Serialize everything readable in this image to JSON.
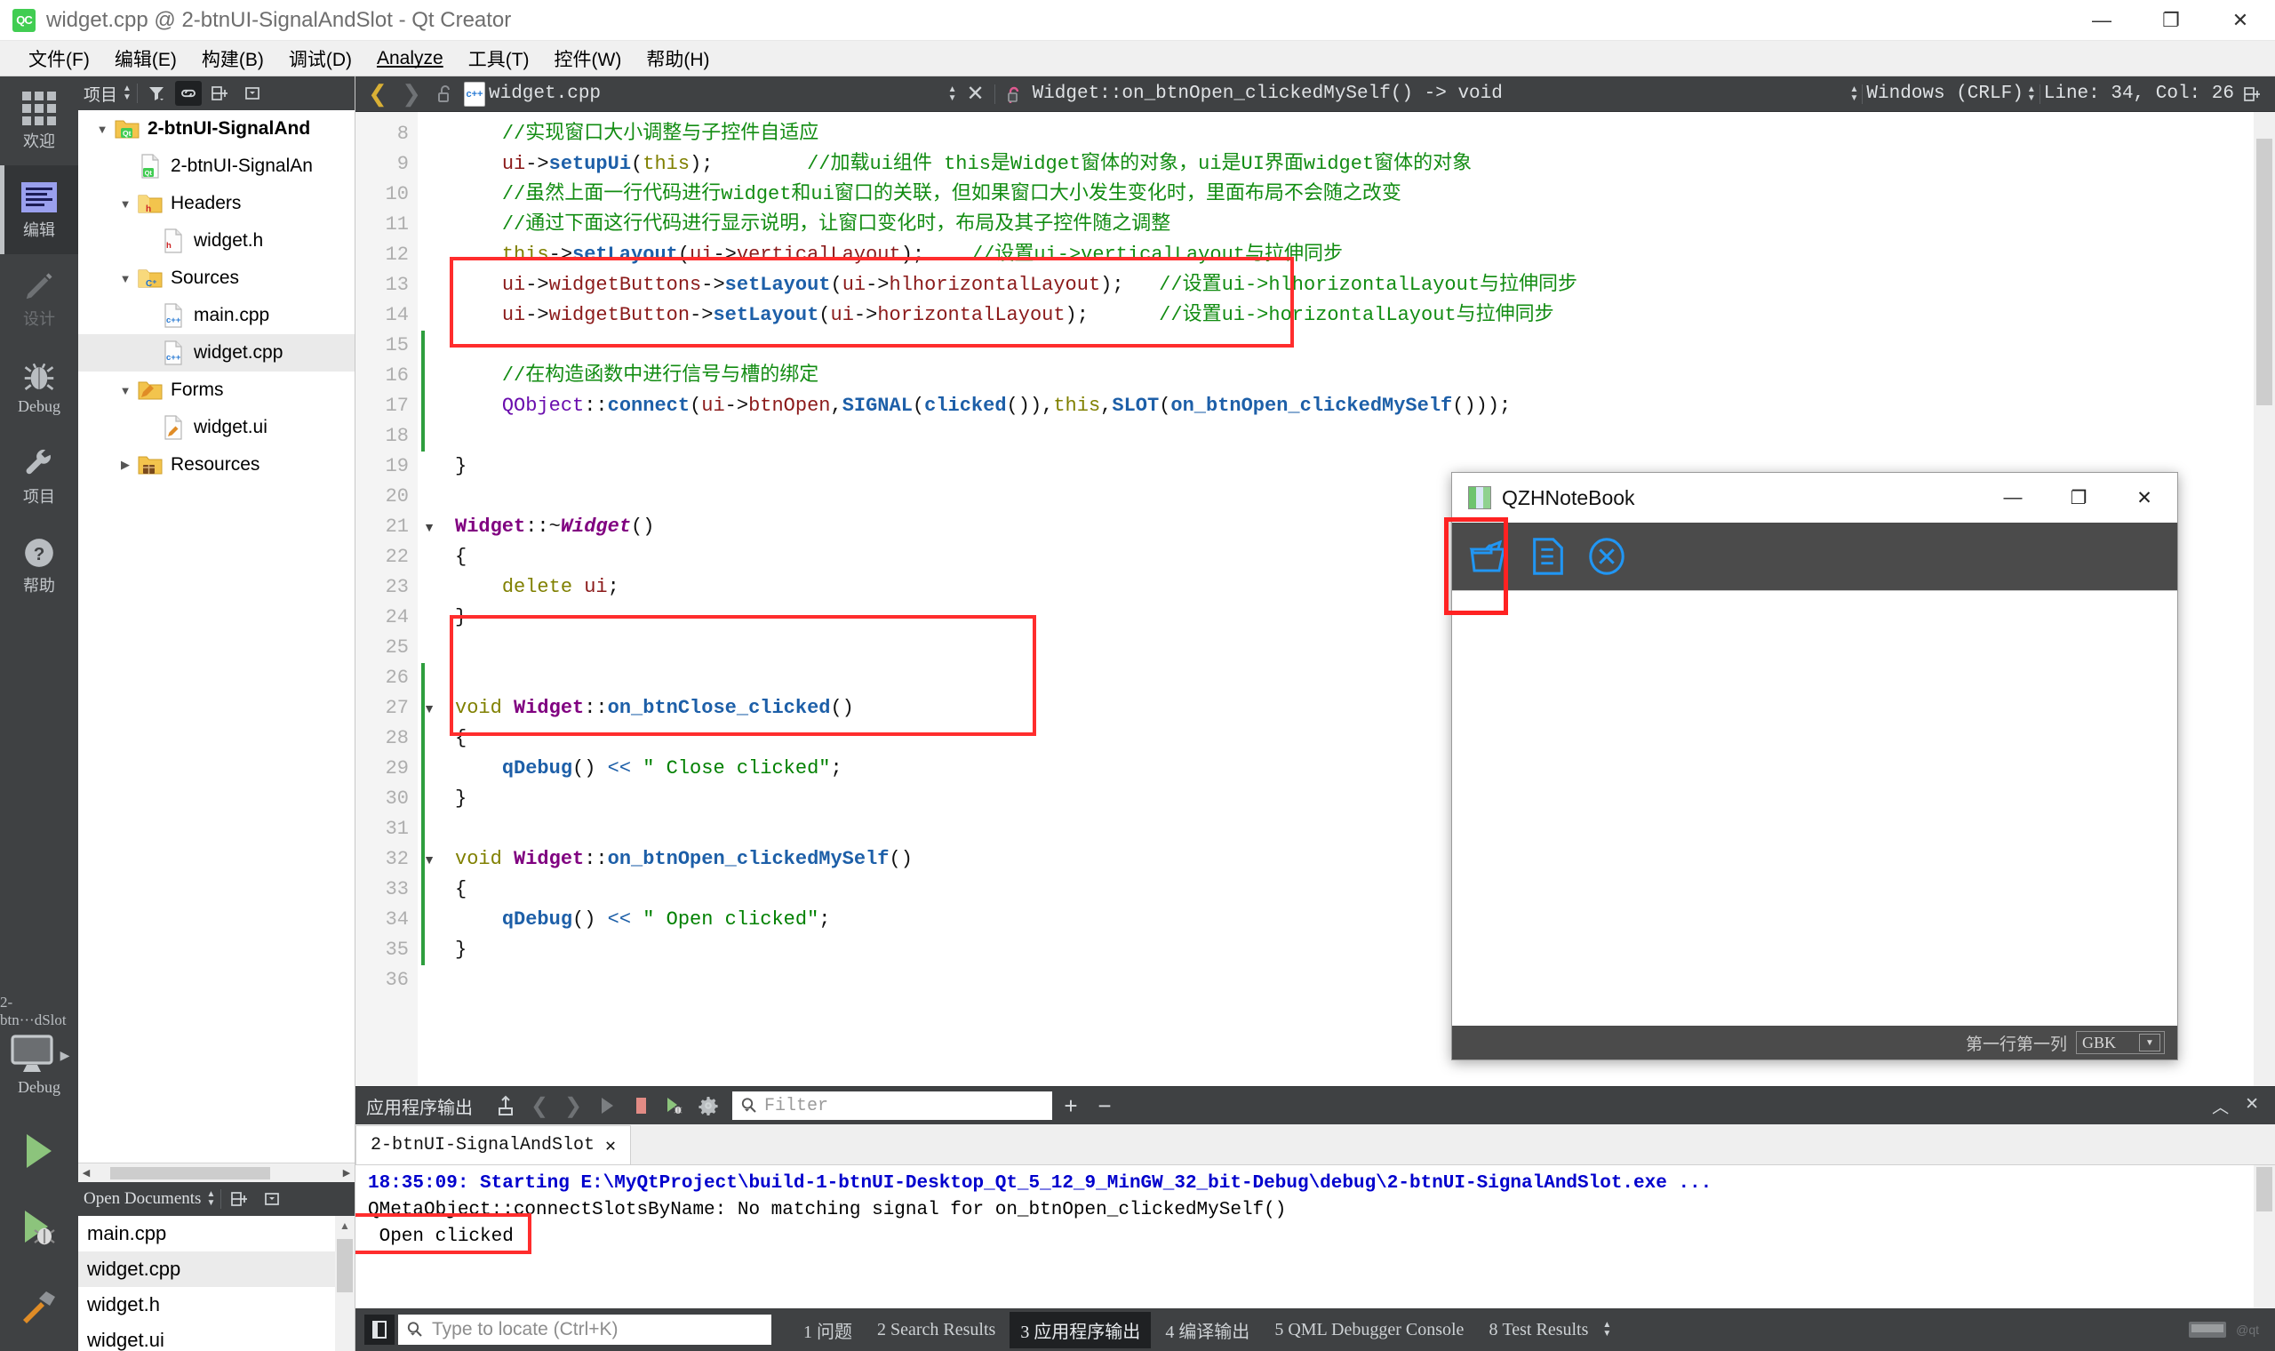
{
  "window": {
    "title": "widget.cpp @ 2-btnUI-SignalAndSlot - Qt Creator",
    "app_icon": "qt-creator-icon",
    "minimize": "—",
    "maximize": "❐",
    "close": "✕"
  },
  "menubar": [
    {
      "label": "文件(F)",
      "mnemonic": "F"
    },
    {
      "label": "编辑(E)",
      "mnemonic": "E"
    },
    {
      "label": "构建(B)",
      "mnemonic": "B"
    },
    {
      "label": "调试(D)",
      "mnemonic": "D"
    },
    {
      "label": "Analyze",
      "mnemonic": "A"
    },
    {
      "label": "工具(T)",
      "mnemonic": "T"
    },
    {
      "label": "控件(W)",
      "mnemonic": "W"
    },
    {
      "label": "帮助(H)",
      "mnemonic": "H"
    }
  ],
  "activity_bar": {
    "items": [
      {
        "label": "欢迎",
        "icon": "grid-icon",
        "selected": false,
        "disabled": false
      },
      {
        "label": "编辑",
        "icon": "editor-icon",
        "selected": true,
        "disabled": false
      },
      {
        "label": "设计",
        "icon": "pencil-icon",
        "selected": false,
        "disabled": true
      },
      {
        "label": "Debug",
        "icon": "bug-icon",
        "selected": false,
        "disabled": false
      },
      {
        "label": "项目",
        "icon": "wrench-icon",
        "selected": false,
        "disabled": false
      },
      {
        "label": "帮助",
        "icon": "question-icon",
        "selected": false,
        "disabled": false
      }
    ],
    "kit_name": "2-btn···dSlot",
    "build_config": "Debug",
    "run_button": "run-icon",
    "debug_button": "run-debug-icon",
    "build_button": "hammer-icon"
  },
  "left_dock": {
    "projects_header": {
      "title": "项目",
      "buttons": [
        "filter-icon",
        "link-icon",
        "split-icon",
        "collapse-icon"
      ]
    },
    "tree": [
      {
        "label": "2-btnUI-SignalAnd",
        "icon": "qt-project-folder-icon",
        "depth": 0,
        "twisty": "down",
        "bold": true,
        "selected": false
      },
      {
        "label": "2-btnUI-SignalAn",
        "icon": "qt-pro-file-icon",
        "depth": 1,
        "twisty": "",
        "bold": false,
        "selected": false
      },
      {
        "label": "Headers",
        "icon": "headers-folder-icon",
        "depth": 1,
        "twisty": "down",
        "bold": false,
        "selected": false
      },
      {
        "label": "widget.h",
        "icon": "h-file-icon",
        "depth": 2,
        "twisty": "",
        "bold": false,
        "selected": false
      },
      {
        "label": "Sources",
        "icon": "sources-folder-icon",
        "depth": 1,
        "twisty": "down",
        "bold": false,
        "selected": false
      },
      {
        "label": "main.cpp",
        "icon": "cpp-file-icon",
        "depth": 2,
        "twisty": "",
        "bold": false,
        "selected": false
      },
      {
        "label": "widget.cpp",
        "icon": "cpp-file-icon",
        "depth": 2,
        "twisty": "",
        "bold": false,
        "selected": true
      },
      {
        "label": "Forms",
        "icon": "forms-folder-icon",
        "depth": 1,
        "twisty": "down",
        "bold": false,
        "selected": false
      },
      {
        "label": "widget.ui",
        "icon": "ui-file-icon",
        "depth": 2,
        "twisty": "",
        "bold": false,
        "selected": false
      },
      {
        "label": "Resources",
        "icon": "resources-folder-icon",
        "depth": 1,
        "twisty": "right",
        "bold": false,
        "selected": false
      }
    ],
    "open_documents": {
      "title": "Open Documents",
      "buttons": [
        "split-icon",
        "collapse-icon"
      ],
      "files": [
        {
          "name": "main.cpp",
          "selected": false
        },
        {
          "name": "widget.cpp",
          "selected": true
        },
        {
          "name": "widget.h",
          "selected": false
        },
        {
          "name": "widget.ui",
          "selected": false
        }
      ]
    }
  },
  "editor_toolbar": {
    "back": "chevron-left-icon",
    "forward": "chevron-right-icon",
    "lock": "unlock-icon",
    "file_badge": "c++",
    "file_name": "widget.cpp",
    "close_file": "✕",
    "symbol_icon": "function-icon",
    "symbol": "Widget::on_btnOpen_clickedMySelf() -> void",
    "line_ending": "Windows (CRLF)",
    "cursor_position": "Line: 34, Col: 26",
    "split_icon": "split-icon"
  },
  "code": {
    "first_line": 8,
    "lines": [
      {
        "n": 8,
        "fold": "",
        "green": false,
        "html": "    <span class='c-com'>//实现窗口大小调整与子控件自适应</span>"
      },
      {
        "n": 9,
        "fold": "",
        "green": false,
        "html": "    <span class='c-var'>ui</span><span class='c-op'>-></span><span class='c-fn'>setupUi</span><span class='c-op'>(</span><span class='c-this'>this</span><span class='c-op'>);</span>        <span class='c-com'>//加载ui组件 this是Widget窗体的对象，ui是UI界面widget窗体的对象</span>"
      },
      {
        "n": 10,
        "fold": "",
        "green": false,
        "html": "    <span class='c-com'>//虽然上面一行代码进行widget和ui窗口的关联，但如果窗口大小发生变化时，里面布局不会随之改变</span>"
      },
      {
        "n": 11,
        "fold": "",
        "green": false,
        "html": "    <span class='c-com'>//通过下面这行代码进行显示说明，让窗口变化时，布局及其子控件随之调整</span>"
      },
      {
        "n": 12,
        "fold": "",
        "green": false,
        "html": "    <span class='c-this'>this</span><span class='c-op'>-></span><span class='c-fn'>setLayout</span><span class='c-op'>(</span><span class='c-var'>ui</span><span class='c-op'>-></span><span class='c-var'>verticalLayout</span><span class='c-op'>);</span>    <span class='c-com'>//设置ui->verticalLayout与拉伸同步</span>"
      },
      {
        "n": 13,
        "fold": "",
        "green": false,
        "html": "    <span class='c-var'>ui</span><span class='c-op'>-></span><span class='c-var'>widgetButtons</span><span class='c-op'>-></span><span class='c-fn'>setLayout</span><span class='c-op'>(</span><span class='c-var'>ui</span><span class='c-op'>-></span><span class='c-var'>hlhorizontalLayout</span><span class='c-op'>);</span>   <span class='c-com'>//设置ui->hlhorizontalLayout与拉伸同步</span>"
      },
      {
        "n": 14,
        "fold": "",
        "green": false,
        "html": "    <span class='c-var'>ui</span><span class='c-op'>-></span><span class='c-var'>widgetButton</span><span class='c-op'>-></span><span class='c-fn'>setLayout</span><span class='c-op'>(</span><span class='c-var'>ui</span><span class='c-op'>-></span><span class='c-var'>horizontalLayout</span><span class='c-op'>);</span>      <span class='c-com'>//设置ui->horizontalLayout与拉伸同步</span>"
      },
      {
        "n": 15,
        "fold": "",
        "green": true,
        "html": ""
      },
      {
        "n": 16,
        "fold": "",
        "green": true,
        "html": "    <span class='c-com'>//在构造函数中进行信号与槽的绑定</span>"
      },
      {
        "n": 17,
        "fold": "",
        "green": true,
        "html": "    <span class='c-ns'>QObject</span><span class='c-op'>::</span><span class='c-fn'>connect</span><span class='c-op'>(</span><span class='c-var'>ui</span><span class='c-op'>-></span><span class='c-var'>btnOpen</span><span class='c-op'>,</span><span class='c-fn'>SIGNAL</span><span class='c-op'>(</span><span class='c-fn'>clicked</span><span class='c-op'>()),</span><span class='c-this'>this</span><span class='c-op'>,</span><span class='c-fn'>SLOT</span><span class='c-op'>(</span><span class='c-fn'>on_btnOpen_clickedMySelf</span><span class='c-op'>()));</span>"
      },
      {
        "n": 18,
        "fold": "",
        "green": true,
        "html": ""
      },
      {
        "n": 19,
        "fold": "",
        "green": false,
        "html": "<span class='c-op'>}</span>"
      },
      {
        "n": 20,
        "fold": "",
        "green": false,
        "html": ""
      },
      {
        "n": 21,
        "fold": "▼",
        "green": false,
        "html": "<span class='c-cls'>Widget</span><span class='c-op'>::~</span><span class='c-cls c-italic'>Widget</span><span class='c-op'>()</span>"
      },
      {
        "n": 22,
        "fold": "",
        "green": false,
        "html": "<span class='c-op'>{</span>"
      },
      {
        "n": 23,
        "fold": "",
        "green": false,
        "html": "    <span class='c-kw'>delete</span> <span class='c-var'>ui</span><span class='c-op'>;</span>"
      },
      {
        "n": 24,
        "fold": "",
        "green": false,
        "html": "<span class='c-op'>}</span>"
      },
      {
        "n": 25,
        "fold": "",
        "green": false,
        "html": ""
      },
      {
        "n": 26,
        "fold": "",
        "green": true,
        "html": ""
      },
      {
        "n": 27,
        "fold": "▼",
        "green": true,
        "html": "<span class='c-kw'>void</span> <span class='c-cls'>Widget</span><span class='c-op'>::</span><span class='c-fn'>on_btnClose_clicked</span><span class='c-op'>()</span>"
      },
      {
        "n": 28,
        "fold": "",
        "green": true,
        "html": "<span class='c-op'>{</span>"
      },
      {
        "n": 29,
        "fold": "",
        "green": true,
        "html": "    <span class='c-fn'>qDebug</span><span class='c-op'>()</span> <span class='c-op' style='color:#1d5fa8'>&lt;&lt;</span> <span class='c-str'>\" Close clicked\"</span><span class='c-op'>;</span>"
      },
      {
        "n": 30,
        "fold": "",
        "green": true,
        "html": "<span class='c-op'>}</span>"
      },
      {
        "n": 31,
        "fold": "",
        "green": true,
        "html": ""
      },
      {
        "n": 32,
        "fold": "▼",
        "green": true,
        "html": "<span class='c-kw'>void</span> <span class='c-cls'>Widget</span><span class='c-op'>::</span><span class='c-fn'>on_btnOpen_clickedMySelf</span><span class='c-op'>()</span>"
      },
      {
        "n": 33,
        "fold": "",
        "green": true,
        "html": "<span class='c-op'>{</span>"
      },
      {
        "n": 34,
        "fold": "",
        "green": true,
        "html": "    <span class='c-fn'>qDebug</span><span class='c-op'>()</span> <span class='c-op' style='color:#1d5fa8'>&lt;&lt;</span> <span class='c-str'>\" Open clicked\"</span><span class='c-op'>;</span>"
      },
      {
        "n": 35,
        "fold": "",
        "green": true,
        "html": "<span class='c-op'>}</span>"
      },
      {
        "n": 36,
        "fold": "",
        "green": false,
        "html": ""
      }
    ]
  },
  "output_pane": {
    "title": "应用程序输出",
    "buttons": [
      "attach-icon",
      "prev-icon",
      "next-icon",
      "run-icon",
      "stop-icon",
      "rerun-debug-icon",
      "settings-icon"
    ],
    "filter_placeholder": "Filter",
    "add": "+",
    "remove": "−",
    "tab": {
      "label": "2-btnUI-SignalAndSlot",
      "close": "✕"
    },
    "lines": [
      {
        "type": "start",
        "text": "18:35:09: Starting E:\\MyQtProject\\build-1-btnUI-Desktop_Qt_5_12_9_MinGW_32_bit-Debug\\debug\\2-btnUI-SignalAndSlot.exe ..."
      },
      {
        "type": "msg",
        "text": "QMetaObject::connectSlotsByName: No matching signal for on_btnOpen_clickedMySelf()"
      },
      {
        "type": "msg",
        "text": " Open clicked"
      }
    ]
  },
  "statusbar": {
    "sidebar_toggle": "sidebar-icon",
    "locator_placeholder": "Type to locate (Ctrl+K)",
    "tabs": [
      {
        "num": "1",
        "label": "问题",
        "active": false
      },
      {
        "num": "2",
        "label": "Search Results",
        "active": false
      },
      {
        "num": "3",
        "label": "应用程序输出",
        "active": true
      },
      {
        "num": "4",
        "label": "编译输出",
        "active": false
      },
      {
        "num": "5",
        "label": "QML Debugger Console",
        "active": false
      },
      {
        "num": "8",
        "label": "Test Results",
        "active": false
      }
    ]
  },
  "notebook_window": {
    "title": "QZHNoteBook",
    "icon": "notebook-icon",
    "minimize": "—",
    "maximize": "❐",
    "close": "✕",
    "toolbar": [
      {
        "name": "open-folder-icon",
        "highlighted": true
      },
      {
        "name": "save-file-icon",
        "highlighted": false
      },
      {
        "name": "close-circle-icon",
        "highlighted": false
      }
    ],
    "status_position": "第一行第一列",
    "status_encoding": "GBK"
  },
  "annotations": {
    "highlight_color": "#ff2222",
    "boxes": [
      {
        "name": "connect-statement-highlight"
      },
      {
        "name": "open-slot-definition-highlight"
      },
      {
        "name": "notebook-open-button-highlight"
      },
      {
        "name": "open-clicked-output-highlight"
      }
    ]
  }
}
